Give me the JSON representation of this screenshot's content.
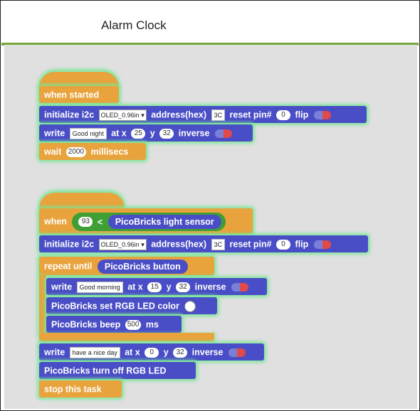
{
  "window": {
    "title": "Alarm Clock"
  },
  "colors": {
    "control": "#e8a33c",
    "oled": "#4a4ec6",
    "operator": "#3f9e34",
    "glow": "#78e696",
    "accent_bar": "#76a83a"
  },
  "script1": {
    "hat_label": "when started",
    "init": {
      "label": "initialize i2c",
      "device": "OLED_0.96in ▾",
      "addr_label": "address(hex)",
      "addr": "3C",
      "reset_label": "reset pin#",
      "reset": "0",
      "flip_label": "flip"
    },
    "write": {
      "label": "write",
      "text": "Good night",
      "x_label": "at x",
      "x": "25",
      "y_label": "y",
      "y": "32",
      "inverse_label": "inverse"
    },
    "wait": {
      "label": "wait",
      "ms": "2000",
      "unit": "millisecs"
    }
  },
  "script2": {
    "when_label": "when",
    "threshold": "93",
    "op": "<",
    "sensor": "PicoBricks light sensor",
    "init": {
      "label": "initialize i2c",
      "device": "OLED_0.96in ▾",
      "addr_label": "address(hex)",
      "addr": "3C",
      "reset_label": "reset pin#",
      "reset": "0",
      "flip_label": "flip"
    },
    "repeat_label": "repeat until",
    "button": "PicoBricks button",
    "inner_write": {
      "label": "write",
      "text": "Good morning",
      "x_label": "at x",
      "x": "15",
      "y_label": "y",
      "y": "32",
      "inverse_label": "inverse"
    },
    "rgb_label": "PicoBricks set RGB LED color",
    "beep": {
      "label": "PicoBricks beep",
      "ms": "500",
      "unit": "ms"
    },
    "write2": {
      "label": "write",
      "text": "have a nice day",
      "x_label": "at x",
      "x": "0",
      "y_label": "y",
      "y": "32",
      "inverse_label": "inverse"
    },
    "rgb_off_label": "PicoBricks turn off RGB LED",
    "stop_label": "stop this task"
  }
}
